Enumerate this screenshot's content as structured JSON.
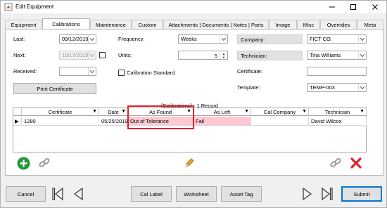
{
  "window": {
    "title": "Edit Equipment"
  },
  "tabs": [
    {
      "label": "Equipment"
    },
    {
      "label": "Calibrations"
    },
    {
      "label": "Maintenance"
    },
    {
      "label": "Custom"
    },
    {
      "label": "Attachments | Documents | Notes | Parts"
    },
    {
      "label": "Image"
    },
    {
      "label": "Misc"
    },
    {
      "label": "Overrides"
    },
    {
      "label": "Meta"
    }
  ],
  "active_tab": "Calibrations",
  "form": {
    "last_label": "Last:",
    "last_value": "09/12/2019",
    "next_label": "Next:",
    "next_value": "10/17/2019",
    "received_label": "Received:",
    "received_value": "",
    "frequency_label": "Frequency:",
    "frequency_value": "Weeks",
    "units_label": "Units:",
    "units_value": "5",
    "cal_standard_label": "Calibration Standard",
    "company_label": "Company:",
    "company_value": "FICT CO.",
    "technician_label": "Technician:",
    "technician_value": "Tina Williams",
    "certificate_label": "Certificate:",
    "certificate_value": "",
    "template_label": "Template:",
    "template_value": "TEMP-003",
    "print_certificate": "Print Certificate"
  },
  "grid": {
    "caption": "[Calibrations] - 1 Record",
    "columns": [
      "Certificate",
      "Date",
      "As Found",
      "As Left",
      "Cal Company",
      "Technician"
    ],
    "rows": [
      {
        "certificate": "1280",
        "date": "05/25/2019",
        "as_found": "Out of Tolerance",
        "as_left": "Fail",
        "cal_company": "",
        "technician": "David Wilcox"
      }
    ]
  },
  "bottom": {
    "cancel": "Cancel",
    "cal_label": "Cal Label",
    "worksheet": "Worksheet",
    "asset_tag": "Asset Tag",
    "submit": "Submit"
  },
  "colors": {
    "error_cell": "#ffc8d2",
    "highlight": "#e0202a",
    "accent": "#0078d7"
  }
}
